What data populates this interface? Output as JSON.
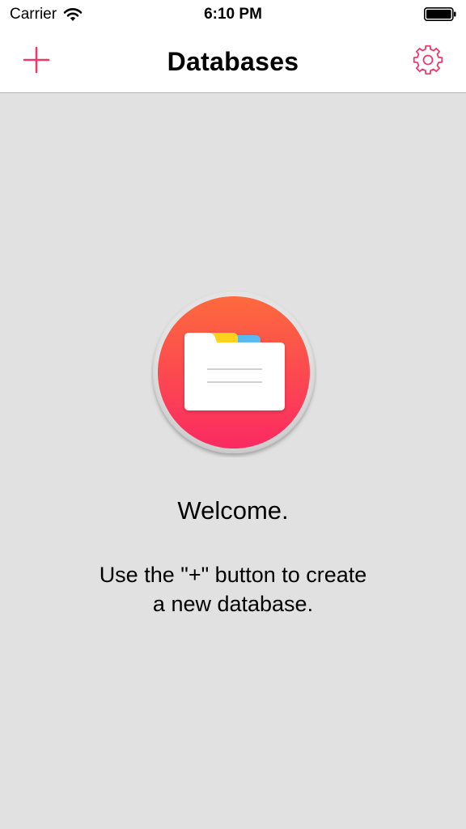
{
  "status_bar": {
    "carrier": "Carrier",
    "time": "6:10 PM"
  },
  "nav": {
    "title": "Databases",
    "add_icon": "plus-icon",
    "settings_icon": "gear-icon",
    "accent_color": "#f0396a"
  },
  "empty_state": {
    "icon": "folder-icon",
    "welcome": "Welcome.",
    "hint_line1": "Use the \"+\" button to create",
    "hint_line2": "a new database."
  }
}
